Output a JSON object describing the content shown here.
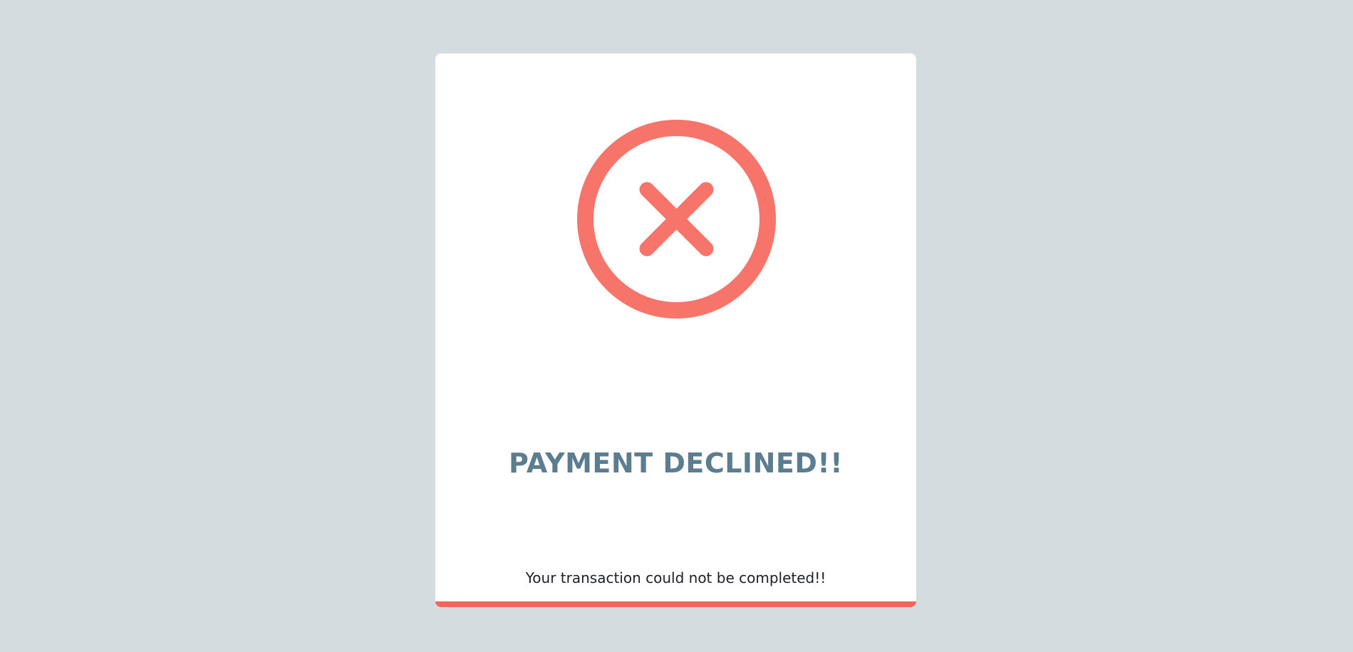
{
  "dialog": {
    "title": "PAYMENT DECLINED!!",
    "message": "Your transaction could not be completed!!",
    "icon": "error-x-circle-icon"
  },
  "colors": {
    "background": "#d4dce0",
    "card": "#ffffff",
    "icon": "#f67469",
    "title": "#5c7d8f",
    "message": "#1c1f24",
    "accent_bar": "#f5655d"
  }
}
